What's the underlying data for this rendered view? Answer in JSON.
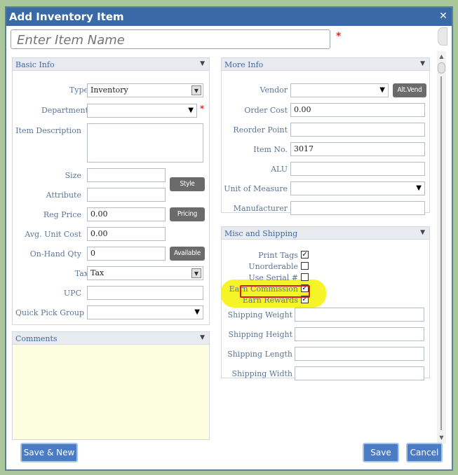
{
  "window": {
    "title": "Add Inventory Item",
    "close": "✕"
  },
  "item_name": {
    "placeholder": "Enter Item Name",
    "required_mark": "*"
  },
  "basic_info": {
    "header": "Basic Info",
    "type_label": "Type",
    "type_value": "Inventory",
    "department_label": "Department",
    "department_required": "*",
    "description_label": "Item Description",
    "size_label": "Size",
    "style_button": "Style",
    "attribute_label": "Attribute",
    "reg_price_label": "Reg Price",
    "reg_price_value": "0.00",
    "pricing_button": "Pricing",
    "avg_cost_label": "Avg. Unit Cost",
    "avg_cost_value": "0.00",
    "onhand_label": "On-Hand Qty",
    "onhand_value": "0",
    "available_button": "Available",
    "tax_label": "Tax",
    "tax_value": "Tax",
    "upc_label": "UPC",
    "quick_pick_label": "Quick Pick Group"
  },
  "more_info": {
    "header": "More Info",
    "vendor_label": "Vendor",
    "alt_vend_button": "Alt.Vend",
    "order_cost_label": "Order Cost",
    "order_cost_value": "0.00",
    "reorder_label": "Reorder Point",
    "item_no_label": "Item No.",
    "item_no_value": "3017",
    "alu_label": "ALU",
    "uom_label": "Unit of Measure",
    "manufacturer_label": "Manufacturer"
  },
  "misc_shipping": {
    "header": "Misc and Shipping",
    "print_tags_label": "Print Tags",
    "unorderable_label": "Unorderable",
    "use_serial_label": "Use Serial #",
    "earn_commission_label": "Earn Commission",
    "earn_rewards_label": "Earn Rewards",
    "shipping_weight_label": "Shipping Weight",
    "shipping_height_label": "Shipping Height",
    "shipping_length_label": "Shipping Length",
    "shipping_width_label": "Shipping Width"
  },
  "comments": {
    "header": "Comments"
  },
  "buttons": {
    "save_new": "Save & New",
    "save": "Save",
    "cancel": "Cancel"
  },
  "icons": {
    "check": "✓",
    "down_arrow": "▼",
    "collapse": "▼",
    "scroll_up": "▲",
    "scroll_down": "▼"
  },
  "colors": {
    "title_bar": "#3a69a8",
    "highlight": "#f5f21a",
    "highlight_box": "#d81c1c",
    "button_blue": "#4a7cc6",
    "comments_bg": "#fdfde0"
  }
}
